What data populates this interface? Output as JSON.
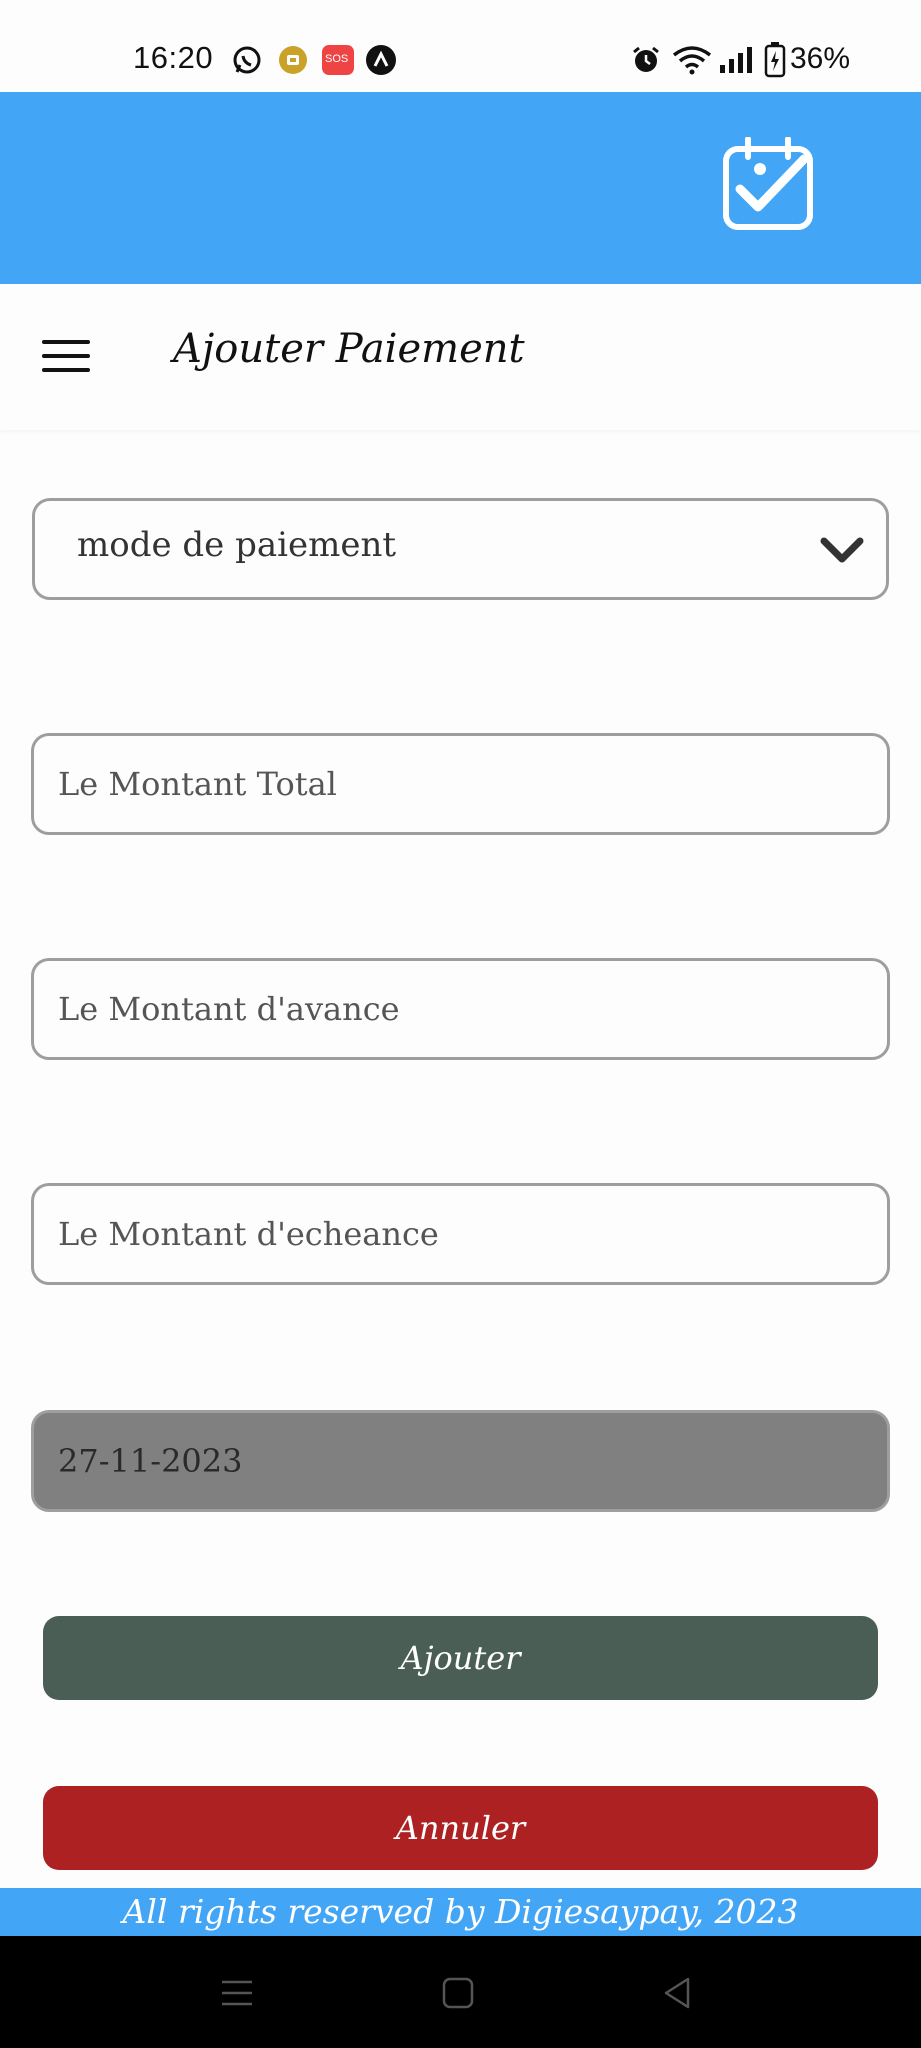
{
  "status_bar": {
    "time": "16:20",
    "notification_icons": [
      "whatsapp-icon",
      "yellow-app-icon",
      "sos-icon",
      "arc-app-icon"
    ],
    "sos_label": "SOS",
    "system_icons": [
      "alarm-icon",
      "wifi-icon",
      "signal-icon",
      "battery-charging-icon"
    ],
    "battery_percent": "36%"
  },
  "banner": {
    "logo_icon": "calendar-check-icon",
    "color": "#42a5f5"
  },
  "toolbar": {
    "menu_icon": "hamburger-menu-icon",
    "title": "Ajouter Paiement"
  },
  "form": {
    "payment_mode": {
      "label": "mode de paiement",
      "icon": "chevron-down-icon"
    },
    "total_amount_placeholder": "Le Montant Total",
    "advance_amount_placeholder": "Le Montant d'avance",
    "due_amount_placeholder": "Le Montant d'echeance",
    "date_value": "27-11-2023"
  },
  "buttons": {
    "add_label": "Ajouter",
    "add_color": "#4b5e55",
    "cancel_label": "Annuler",
    "cancel_color": "#ae2123"
  },
  "footer": {
    "text": "All rights reserved by Digiesaypay, 2023"
  },
  "nav_bar": {
    "icons": [
      "recent-apps-icon",
      "home-icon",
      "back-icon"
    ]
  }
}
